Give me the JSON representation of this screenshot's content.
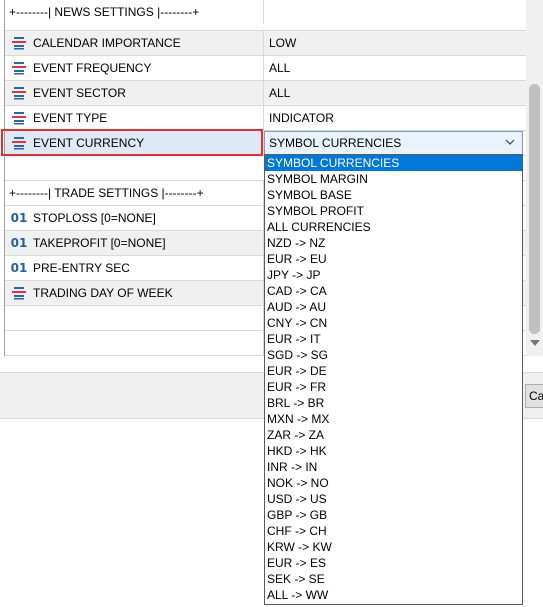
{
  "news_settings_header": "+--------| NEWS SETTINGS |--------+",
  "trade_settings_header": "+--------| TRADE SETTINGS |--------+",
  "rows": [
    {
      "name": "CALENDAR IMPORTANCE",
      "value": "LOW",
      "icon": "enum-icon"
    },
    {
      "name": "EVENT FREQUENCY",
      "value": "ALL",
      "icon": "enum-icon"
    },
    {
      "name": "EVENT SECTOR",
      "value": "ALL",
      "icon": "enum-icon"
    },
    {
      "name": "EVENT TYPE",
      "value": "INDICATOR",
      "icon": "enum-icon"
    },
    {
      "name": "EVENT CURRENCY",
      "value": "SYMBOL CURRENCIES",
      "icon": "enum-icon"
    }
  ],
  "trade_rows": [
    {
      "name": "STOPLOSS [0=NONE]",
      "icon": "integer-icon",
      "icon_text": "01"
    },
    {
      "name": "TAKEPROFIT [0=NONE]",
      "icon": "integer-icon",
      "icon_text": "01"
    },
    {
      "name": "PRE-ENTRY SEC",
      "icon": "integer-icon",
      "icon_text": "01"
    },
    {
      "name": "TRADING DAY OF WEEK",
      "icon": "enum-icon"
    }
  ],
  "dropdown_options": [
    "SYMBOL CURRENCIES",
    "SYMBOL MARGIN",
    "SYMBOL BASE",
    "SYMBOL PROFIT",
    "ALL CURRENCIES",
    "NZD -> NZ",
    "EUR -> EU",
    "JPY -> JP",
    "CAD -> CA",
    "AUD -> AU",
    "CNY -> CN",
    "EUR -> IT",
    "SGD -> SG",
    "EUR -> DE",
    "EUR -> FR",
    "BRL -> BR",
    "MXN -> MX",
    "ZAR -> ZA",
    "HKD -> HK",
    "INR -> IN",
    "NOK -> NO",
    "USD -> US",
    "GBP -> GB",
    "CHF -> CH",
    "KRW -> KW",
    "EUR -> ES",
    "SEK -> SE",
    "ALL -> WW"
  ],
  "cancel_label": "Ca",
  "colors": {
    "accent": "#0078d7",
    "selection_outline": "#e03131",
    "enum_icon_blue": "#2a64b0",
    "enum_icon_red": "#d23b3b"
  }
}
